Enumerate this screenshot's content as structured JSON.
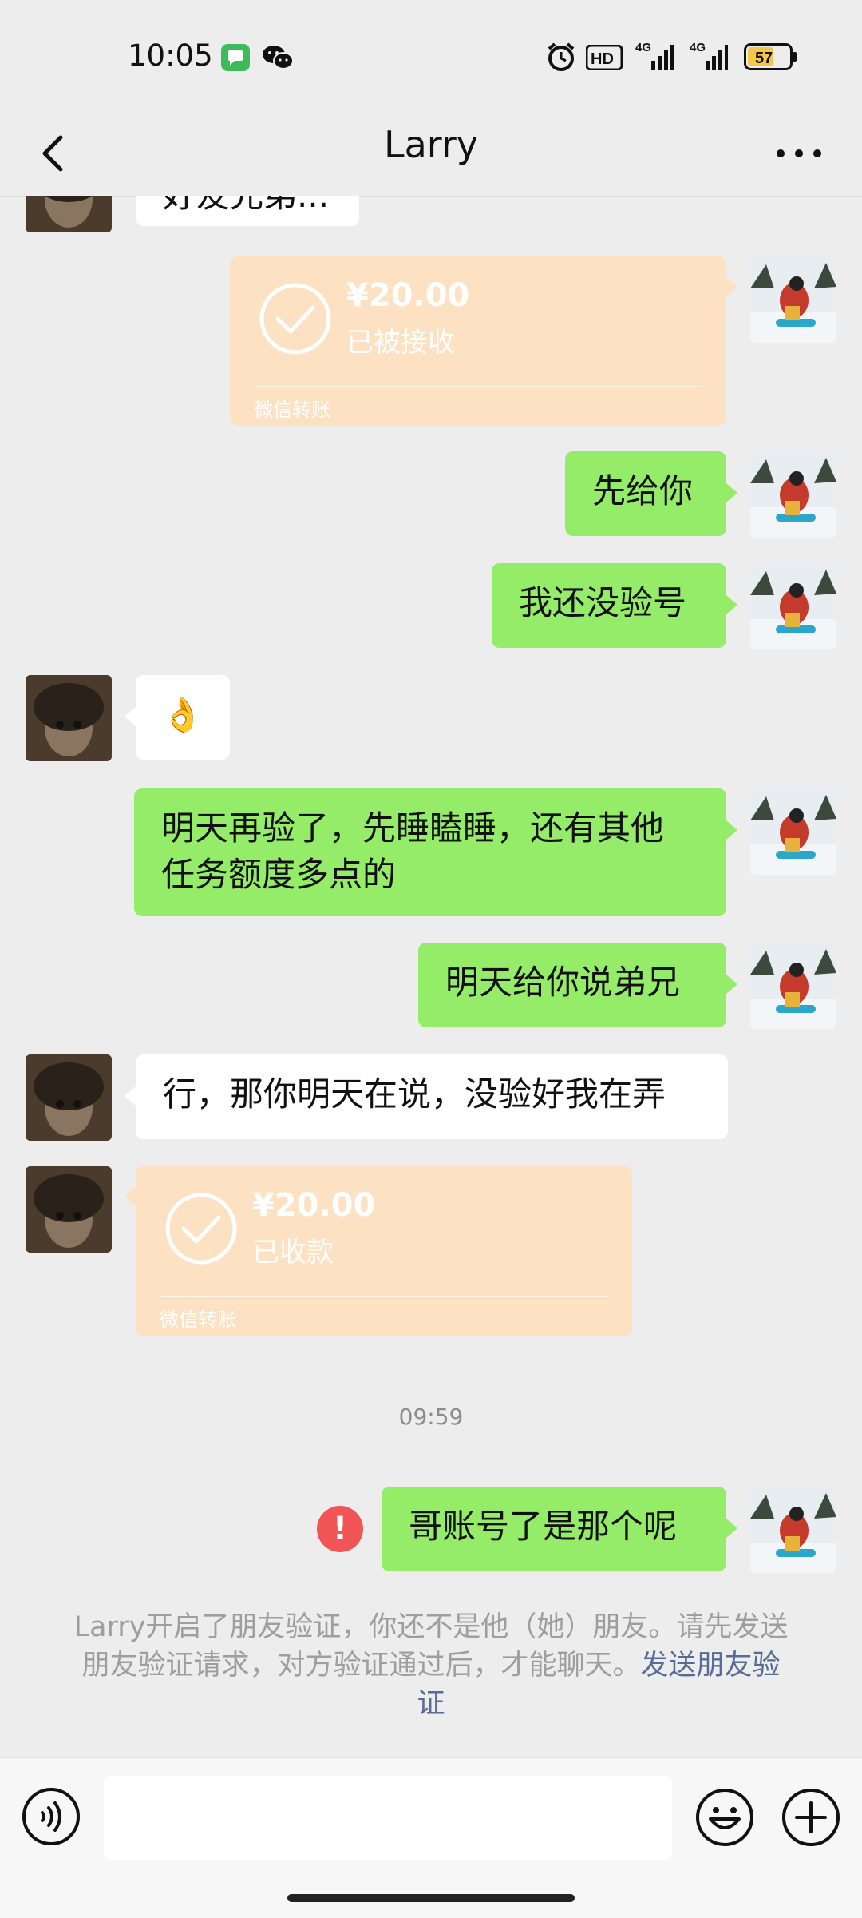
{
  "status_bar": {
    "time": "10:05",
    "network_1": "4G",
    "network_2": "4G",
    "hd_label": "HD",
    "battery": "57",
    "icons": [
      "messages-app-icon",
      "wechat-icon",
      "alarm-icon",
      "hd-voice-icon",
      "signal-icon",
      "signal-icon",
      "battery-icon"
    ]
  },
  "header": {
    "title": "Larry",
    "back_icon": "chevron-left-icon",
    "more_icon": "more-dots-icon"
  },
  "messages": [
    {
      "side": "left",
      "type": "text",
      "text": "好友兄弟..."
    },
    {
      "side": "right",
      "type": "transfer",
      "amount": "¥20.00",
      "status": "已被接收",
      "footer": "微信转账"
    },
    {
      "side": "right",
      "type": "text",
      "text": "先给你"
    },
    {
      "side": "right",
      "type": "text",
      "text": "我还没验号"
    },
    {
      "side": "left",
      "type": "text",
      "text": "👌"
    },
    {
      "side": "right",
      "type": "text",
      "line1": "明天再验了，先睡瞌睡，还有其他",
      "line2": "任务额度多点的"
    },
    {
      "side": "right",
      "type": "text",
      "text": "明天给你说弟兄"
    },
    {
      "side": "left",
      "type": "text",
      "text": "行，那你明天在说，没验好我在弄"
    },
    {
      "side": "left",
      "type": "transfer",
      "amount": "¥20.00",
      "status": "已收款",
      "footer": "微信转账"
    },
    {
      "side": "right",
      "type": "text",
      "text": "哥账号了是那个呢",
      "failed": true
    }
  ],
  "timestamp": "09:59",
  "error_mark": "!",
  "notice": {
    "text": "Larry开启了朋友验证，你还不是他（她）朋友。请先发送朋友验证请求，对方验证通过后，才能聊天。",
    "link": "发送朋友验证"
  },
  "input_bar": {
    "placeholder": "",
    "icons": [
      "voice-icon",
      "emoji-icon",
      "plus-icon"
    ]
  },
  "colors": {
    "sent_bubble": "#95ec69",
    "received_bubble": "#ffffff",
    "transfer_bubble": "#fde1c3",
    "error": "#f25555",
    "link": "#576b95",
    "background": "#ededed"
  }
}
